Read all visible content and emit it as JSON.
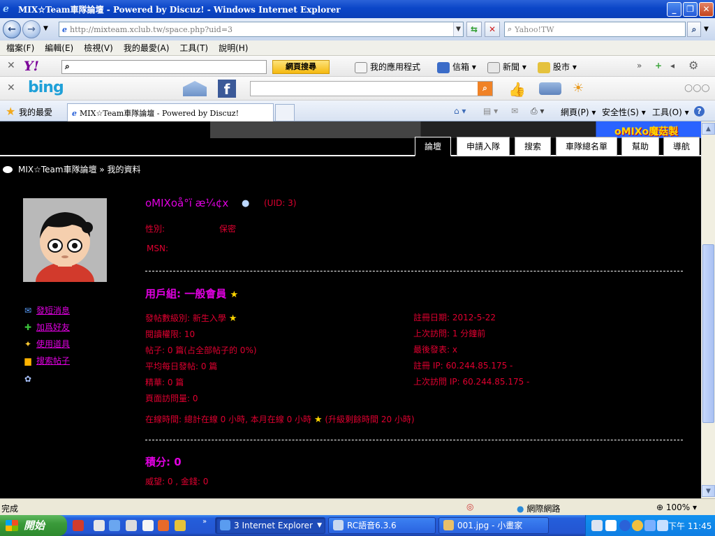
{
  "window": {
    "title": "MIX☆Team車隊論壇 - Powered by Discuz! - Windows Internet Explorer"
  },
  "addressbar": {
    "url": "http://mixteam.xclub.tw/space.php?uid=3",
    "search_placeholder": "Yahoo!TW"
  },
  "menu": {
    "items": [
      "檔案(F)",
      "編輯(E)",
      "檢視(V)",
      "我的最愛(A)",
      "工具(T)",
      "說明(H)"
    ]
  },
  "yahoo_toolbar": {
    "logo": "Y!",
    "search_button": "網頁搜尋",
    "apps": "我的應用程式",
    "mail": "信箱",
    "news": "新聞",
    "stocks": "股市"
  },
  "bing_toolbar": {
    "logo": "bing"
  },
  "favorites_bar": {
    "favorites_label": "我的最愛",
    "active_tab": "MIX☆Team車隊論壇 - Powered by Discuz!",
    "page_menu": "網頁(P)",
    "safety_menu": "安全性(S)",
    "tools_menu": "工具(O)"
  },
  "forum": {
    "banner_text": "oMIXo魔菇製",
    "nav_tabs": [
      "論壇",
      "申請入隊",
      "搜索",
      "車隊總名單",
      "幫助",
      "導航"
    ],
    "active_tab": "論壇",
    "breadcrumb": "MIX☆Team車隊論壇 » 我的資料"
  },
  "sidebar": {
    "links": [
      {
        "icon": "envelope-icon",
        "label": "發短消息"
      },
      {
        "icon": "plus-icon",
        "label": "加爲好友"
      },
      {
        "icon": "wand-icon",
        "label": "使用道具"
      },
      {
        "icon": "chat-bubble-icon",
        "label": "搜索帖子"
      }
    ]
  },
  "profile": {
    "name": "oMIXoå°ï æ¼¢x",
    "uid": "(UID: 3)",
    "gender_label": "性別:",
    "gender_value": "保密",
    "msn_label": "MSN:",
    "usergroup": "用戶組: 一般會員",
    "left_stats": [
      "發帖數級別: 新生入學",
      "閱讀權限: 10",
      "帖子: 0 篇(占全部帖子的 0%)",
      "平均每日發帖: 0 篇",
      "精華: 0 篇",
      "頁面訪問量: 0"
    ],
    "right_stats": [
      "註冊日期: 2012-5-22",
      "上次訪問: 1 分鐘前",
      "最後發表: x",
      "註冊 IP: 60.244.85.175 -",
      "上次訪問 IP: 60.244.85.175 -"
    ],
    "online_time_a": "在線時間: 總計在線 0 小時, 本月在線 0 小時",
    "online_time_b": "(升級剩餘時間 20 小時)",
    "points_title": "積分: 0",
    "points_detail": "威望: 0 , 金錢: 0"
  },
  "statusbar": {
    "status": "完成",
    "zone": "網際網路",
    "zoom": "100%"
  },
  "taskbar": {
    "start": "開始",
    "tasks": [
      "3 Internet Explorer",
      "RC語音6.3.6",
      "001.jpg - 小畫家"
    ],
    "clock": "下午 11:45"
  }
}
